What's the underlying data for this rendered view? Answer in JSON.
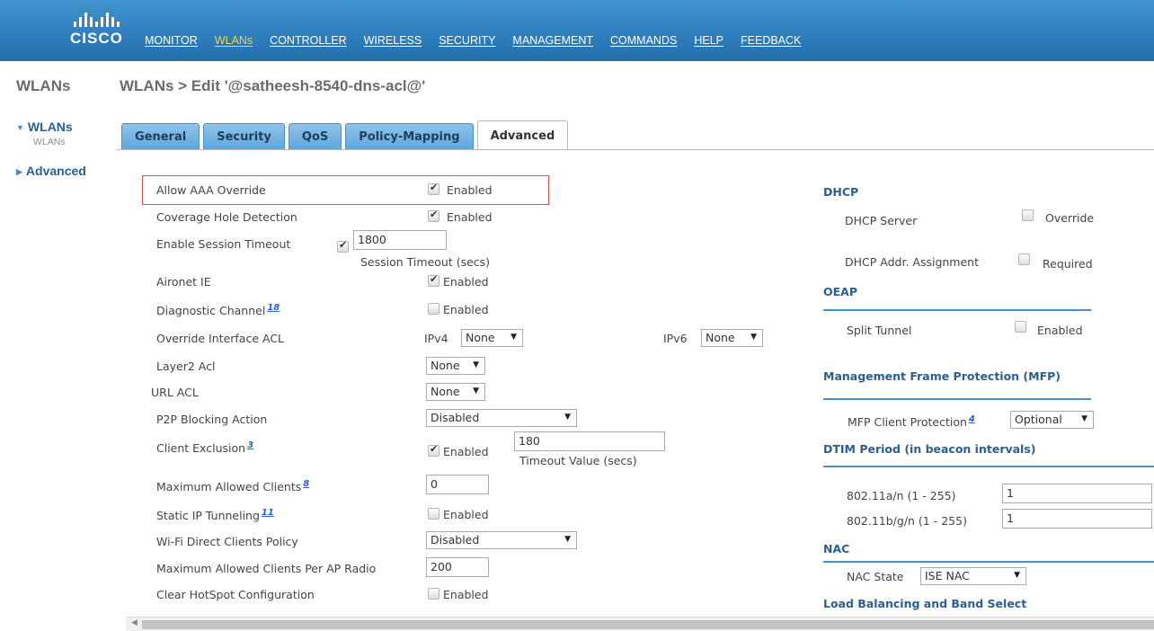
{
  "brand": {
    "wordmark": "CISCO"
  },
  "nav": {
    "items": [
      {
        "label": "MONITOR"
      },
      {
        "label": "WLANs",
        "active": true
      },
      {
        "label": "CONTROLLER"
      },
      {
        "label": "WIRELESS"
      },
      {
        "label": "SECURITY"
      },
      {
        "label": "MANAGEMENT"
      },
      {
        "label": "COMMANDS"
      },
      {
        "label": "HELP"
      },
      {
        "label": "FEEDBACK"
      }
    ]
  },
  "sidebar": {
    "section_title": "WLANs",
    "tree": [
      {
        "label": "WLANs",
        "expanded": true,
        "children": [
          "WLANs"
        ]
      },
      {
        "label": "Advanced",
        "expanded": false
      }
    ]
  },
  "page": {
    "title": "WLANs > Edit  '@satheesh-8540-dns-acl@'"
  },
  "tabs": [
    {
      "label": "General"
    },
    {
      "label": "Security"
    },
    {
      "label": "QoS"
    },
    {
      "label": "Policy-Mapping"
    },
    {
      "label": "Advanced",
      "active": true
    }
  ],
  "left_form": {
    "allow_aaa": {
      "label": "Allow AAA Override",
      "checked": true,
      "option": "Enabled"
    },
    "coverage_hole": {
      "label": "Coverage Hole Detection",
      "checked": true,
      "option": "Enabled"
    },
    "session_timeout": {
      "label": "Enable Session Timeout",
      "checked": true,
      "value": "1800",
      "hint": "Session Timeout (secs)"
    },
    "aironet_ie": {
      "label": "Aironet IE",
      "checked": true,
      "option": "Enabled"
    },
    "diag_channel": {
      "label": "Diagnostic Channel",
      "footnote": "18",
      "checked": false,
      "option": "Enabled"
    },
    "override_acl": {
      "label": "Override Interface ACL",
      "ipv4_label": "IPv4",
      "ipv4_value": "None",
      "ipv6_label": "IPv6",
      "ipv6_value": "None"
    },
    "layer2_acl": {
      "label": "Layer2 Acl",
      "value": "None"
    },
    "url_acl": {
      "label": "URL ACL",
      "value": "None"
    },
    "p2p_blocking": {
      "label": "P2P Blocking Action",
      "value": "Disabled"
    },
    "client_exclusion": {
      "label": "Client Exclusion",
      "footnote": "3",
      "checked": true,
      "option": "Enabled",
      "value": "180",
      "hint": "Timeout Value (secs)"
    },
    "max_clients": {
      "label": "Maximum Allowed Clients",
      "footnote": "8",
      "value": "0"
    },
    "static_ip": {
      "label": "Static IP Tunneling",
      "footnote": "11",
      "checked": false,
      "option": "Enabled"
    },
    "wifi_direct": {
      "label": "Wi-Fi Direct Clients Policy",
      "value": "Disabled"
    },
    "max_per_radio": {
      "label": "Maximum Allowed Clients Per AP Radio",
      "value": "200"
    },
    "clear_hotspot": {
      "label": "Clear HotSpot Configuration",
      "checked": false,
      "option": "Enabled"
    }
  },
  "right_form": {
    "dhcp": {
      "heading": "DHCP",
      "server_label": "DHCP Server",
      "server_option": "Override",
      "server_checked": false,
      "addr_label": "DHCP Addr. Assignment",
      "addr_option": "Required",
      "addr_checked": false
    },
    "oeap": {
      "heading": "OEAP",
      "split_label": "Split Tunnel",
      "split_option": "Enabled",
      "split_checked": false
    },
    "mfp": {
      "heading": "Management Frame Protection (MFP)",
      "client_label": "MFP Client Protection",
      "footnote": "4",
      "client_value": "Optional"
    },
    "dtim": {
      "heading": "DTIM Period (in beacon intervals)",
      "a_label": "802.11a/n (1 - 255)",
      "a_value": "1",
      "bg_label": "802.11b/g/n (1 - 255)",
      "bg_value": "1"
    },
    "nac": {
      "heading": "NAC",
      "state_label": "NAC State",
      "state_value": "ISE NAC"
    },
    "load_balancing": {
      "heading": "Load Balancing and Band Select"
    }
  }
}
